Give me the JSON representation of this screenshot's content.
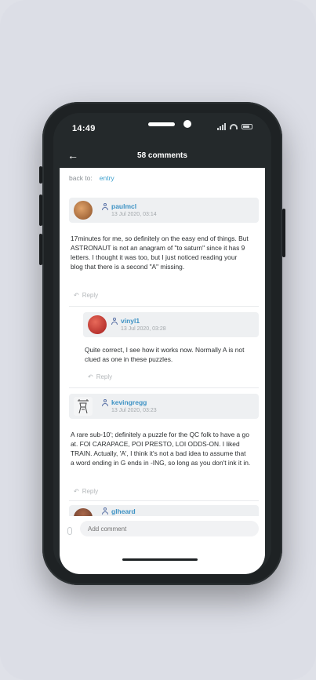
{
  "status": {
    "time": "14:49"
  },
  "nav": {
    "title": "58 comments",
    "back_icon": "arrow-left-icon"
  },
  "back_to": {
    "label": "back to:",
    "link": "entry"
  },
  "comments": [
    {
      "username": "paulmcl",
      "date": "13 Jul 2020, 03:14",
      "text": "17minutes for me, so definitely on the easy end of things. But ASTRONAUT is not an anagram of \"to saturn\" since it has 9 letters. I thought it was too, but I just noticed reading your blog that there is a second \"A\" missing.",
      "reply": "Reply",
      "avatar_color": "#b8743c"
    },
    {
      "username": "vinyl1",
      "date": "13 Jul 2020, 03:28",
      "text": "Quite correct, I see how it works now. Normally A is not clued as one in these puzzles.",
      "reply": "Reply",
      "avatar_color": "#c8342f"
    },
    {
      "username": "kevingregg",
      "date": "13 Jul 2020, 03:23",
      "text": "A rare sub-10'; definitely a puzzle for the QC folk to have a go at. FOI CARAPACE, POI PRESTO, LOI ODDS-ON. I liked TRAIN. Actually, 'A', I think it's not a bad idea to assume that a word ending in G ends in -ING, so long as you don't ink it in.",
      "reply": "Reply",
      "avatar_color": "#9aa0a4"
    },
    {
      "username": "glheard",
      "date": "",
      "text": "",
      "reply": "",
      "avatar_color": "#7a4a35"
    }
  ],
  "input": {
    "placeholder": "Add comment"
  }
}
